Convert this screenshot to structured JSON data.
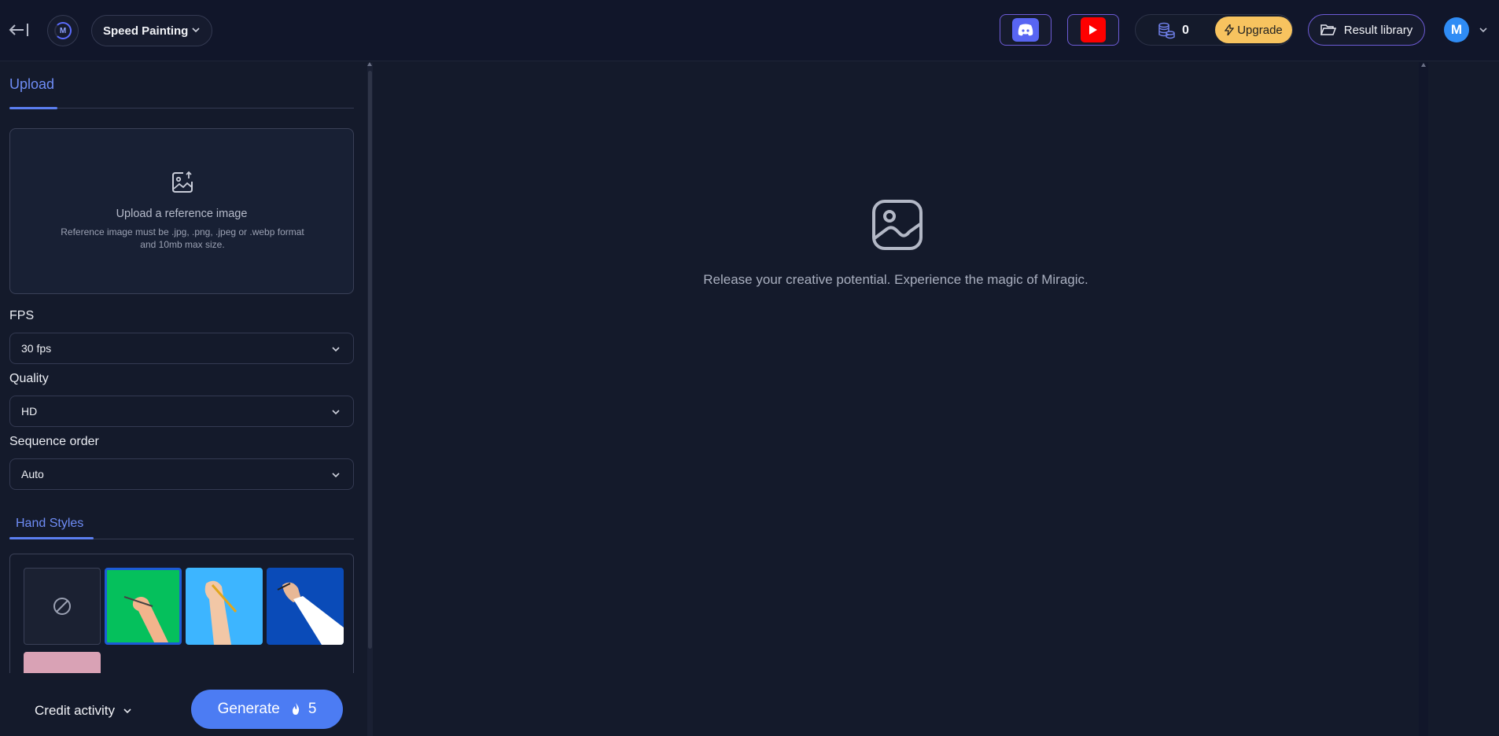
{
  "header": {
    "app_name": "Speed Painting",
    "credit_count": "0",
    "upgrade_label": "Upgrade",
    "library_label": "Result library",
    "avatar_initial": "M",
    "logo_letter": "M"
  },
  "sidebar": {
    "upload_tab": "Upload",
    "upload_title": "Upload a reference image",
    "upload_hint": "Reference image must be .jpg, .png, .jpeg or .webp format and 10mb max size.",
    "fps": {
      "label": "FPS",
      "value": "30 fps"
    },
    "quality": {
      "label": "Quality",
      "value": "HD"
    },
    "sequence": {
      "label": "Sequence order",
      "value": "Auto"
    },
    "hand_styles_tab": "Hand Styles",
    "hand_styles": [
      {
        "name": "none",
        "selected": false
      },
      {
        "name": "green",
        "selected": true,
        "color": "#05c05c"
      },
      {
        "name": "sky-blue",
        "selected": false,
        "color": "#3db5ff"
      },
      {
        "name": "blue",
        "selected": false,
        "color": "#0a4bb8"
      },
      {
        "name": "pink",
        "selected": false,
        "color": "#d9a2b5"
      }
    ]
  },
  "footer": {
    "credit_activity_label": "Credit activity",
    "generate_label": "Generate",
    "generate_cost": "5"
  },
  "main": {
    "empty_message": "Release your creative potential. Experience the magic of Miragic."
  },
  "colors": {
    "accent": "#4c7cf3",
    "upgrade": "#f7c35f",
    "background": "#141a2b"
  }
}
